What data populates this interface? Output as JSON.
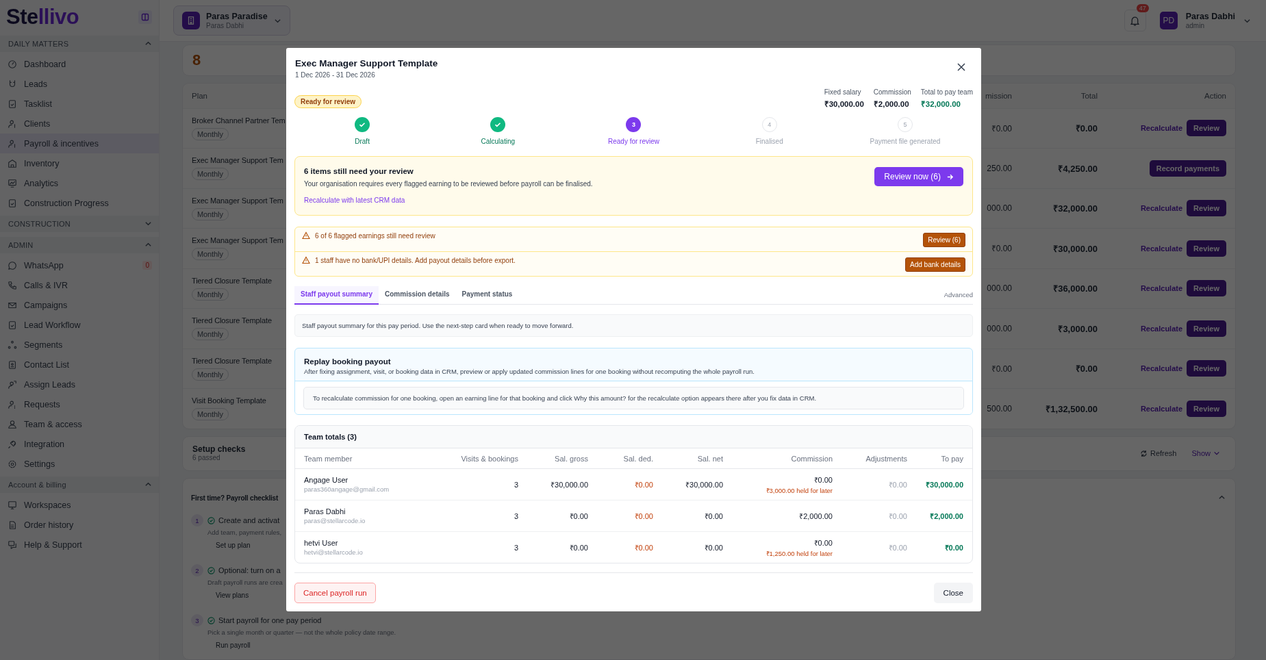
{
  "sidebar": {
    "logo": "Stellivo",
    "sections": [
      {
        "title": "DAILY MATTERS",
        "expanded": true,
        "items": [
          {
            "label": "Dashboard",
            "selected": false
          },
          {
            "label": "Leads",
            "selected": false
          },
          {
            "label": "Tasklist",
            "selected": false
          },
          {
            "label": "Clients",
            "selected": false
          },
          {
            "label": "Payroll & incentives",
            "selected": true
          },
          {
            "label": "Inventory",
            "selected": false
          },
          {
            "label": "Analytics",
            "selected": false
          },
          {
            "label": "Construction Progress",
            "selected": false
          }
        ]
      },
      {
        "title": "CONSTRUCTION",
        "expanded": false
      },
      {
        "title": "ADMIN",
        "expanded": true,
        "items": [
          {
            "label": "WhatsApp",
            "selected": false,
            "badge": "0"
          },
          {
            "label": "Calls & IVR",
            "selected": false
          },
          {
            "label": "Campaigns",
            "selected": false
          },
          {
            "label": "Lead Workflow",
            "selected": false
          },
          {
            "label": "Segments",
            "selected": false
          },
          {
            "label": "Contact List",
            "selected": false
          },
          {
            "label": "Assign Leads",
            "selected": false
          },
          {
            "label": "Requests",
            "selected": false
          },
          {
            "label": "Team & access",
            "selected": false
          },
          {
            "label": "Integration",
            "selected": false
          },
          {
            "label": "Settings",
            "selected": false
          }
        ]
      },
      {
        "title": "Account & billing",
        "expanded": true,
        "items": [
          {
            "label": "Workspaces",
            "selected": false
          },
          {
            "label": "Order history",
            "selected": false
          },
          {
            "label": "Help & Support",
            "selected": false
          }
        ]
      }
    ]
  },
  "topbar": {
    "workspace": {
      "name": "Paras Paradise",
      "owner": "Paras Dabhi"
    },
    "notifications": "47",
    "user": {
      "initials": "PD",
      "name": "Paras Dabhi",
      "role": "admin"
    }
  },
  "background": {
    "stat": "8",
    "table": {
      "columns": [
        "Plan",
        "mission",
        "Total",
        "Action"
      ],
      "rows": [
        {
          "plan": "Broker Channel Partner Tem",
          "frequency": "Monthly",
          "commission": "₹0.00",
          "total": "₹0.00",
          "kind": "review",
          "actions": [
            "Recalculate",
            "Review"
          ]
        },
        {
          "plan": "Exec Manager Support Tem",
          "frequency": "Monthly",
          "commission": "250.00",
          "total": "₹4,250.00",
          "kind": "record",
          "actions": [
            "Record payments"
          ]
        },
        {
          "plan": "Exec Manager Support Tem",
          "frequency": "Monthly",
          "commission": "000.00",
          "total": "₹32,000.00",
          "kind": "review",
          "actions": [
            "Recalculate",
            "Review"
          ]
        },
        {
          "plan": "Exec Manager Support Tem",
          "frequency": "Monthly",
          "commission": "₹0.00",
          "total": "₹30,000.00",
          "kind": "review",
          "actions": [
            "Recalculate",
            "Review"
          ]
        },
        {
          "plan": "Tiered Closure Template",
          "frequency": "Monthly",
          "commission": "000.00",
          "total": "₹36,000.00",
          "kind": "review",
          "actions": [
            "Recalculate",
            "Review"
          ]
        },
        {
          "plan": "Tiered Closure Template",
          "frequency": "Monthly",
          "commission": "000.00",
          "total": "₹3,000.00",
          "kind": "review",
          "actions": [
            "Recalculate",
            "Review"
          ]
        },
        {
          "plan": "Tiered Closure Template",
          "frequency": "Monthly",
          "commission": "₹0.00",
          "total": "₹0.00",
          "kind": "review",
          "actions": [
            "Recalculate",
            "Review"
          ]
        },
        {
          "plan": "Visit Booking Template",
          "frequency": "Monthly",
          "commission": "500.00",
          "total": "₹1,32,500.00",
          "kind": "review",
          "actions": [
            "Recalculate",
            "Review"
          ]
        }
      ]
    },
    "setup_checks": {
      "title": "Setup checks",
      "subtitle": "6 passed",
      "refresh": "Refresh",
      "show": "Show"
    },
    "checklist": {
      "title": "First time? Payroll checklist",
      "expanded": true,
      "steps": [
        {
          "number": "1",
          "title": "Create and activat",
          "text": "Add team, payment rules,",
          "action": "Set up plan"
        },
        {
          "number": "2",
          "title": "Optional: turn on a",
          "text": "Draft payroll runs are crea",
          "action": "View plans"
        },
        {
          "number": "3",
          "title": "Start payroll for one pay period",
          "text": "Pick a single month or quarter — not the whole policy date range.",
          "action": "Run payroll"
        }
      ]
    }
  },
  "modal": {
    "title": "Exec Manager Support Template",
    "period": "1 Dec 2026 - 31 Dec 2026",
    "status": "Ready for review",
    "totals": [
      {
        "label": "Fixed salary",
        "value": "₹30,000.00",
        "highlight": false
      },
      {
        "label": "Commission",
        "value": "₹2,000.00",
        "highlight": false
      },
      {
        "label": "Total to pay team",
        "value": "₹32,000.00",
        "highlight": true
      }
    ],
    "steps": [
      {
        "label": "Draft",
        "completed": true,
        "current": false
      },
      {
        "label": "Calculating",
        "completed": true,
        "current": false
      },
      {
        "number": "3",
        "label": "Ready for review",
        "completed": false,
        "current": true
      },
      {
        "number": "4",
        "label": "Finalised",
        "completed": false,
        "current": false
      },
      {
        "number": "5",
        "label": "Payment file generated",
        "completed": false,
        "current": false
      }
    ],
    "review_card": {
      "title": "6 items still need your review",
      "text": "Your organisation requires every flagged earning to be reviewed before payroll can be finalised.",
      "link": "Recalculate with latest CRM data",
      "button": "Review now (6)"
    },
    "alerts": [
      {
        "text": "6 of 6 flagged earnings still need review",
        "button": "Review (6)"
      },
      {
        "text": "1 staff have no bank/UPI details. Add payout details before export.",
        "button": "Add bank details"
      }
    ],
    "tabs": [
      {
        "label": "Staff payout summary",
        "selected": true
      },
      {
        "label": "Commission details",
        "selected": false
      },
      {
        "label": "Payment status",
        "selected": false
      }
    ],
    "advanced": "Advanced",
    "info": "Staff payout summary for this pay period. Use the next-step card when ready to move forward.",
    "replay": {
      "title": "Replay booking payout",
      "text": "After fixing assignment, visit, or booking data in CRM, preview or apply updated commission lines for one booking without recomputing the whole payroll run.",
      "hint": "To recalculate commission for one booking, open an earning line for that booking and click Why this amount? for the recalculate option appears there after you fix data in CRM."
    },
    "team": {
      "title": "Team totals (3)",
      "columns": [
        "Team member",
        "Visits & bookings",
        "Sal. gross",
        "Sal. ded.",
        "Sal. net",
        "Commission",
        "Adjustments",
        "To pay"
      ],
      "rows": [
        {
          "name": "Angage User",
          "email": "paras360angage@gmail.com",
          "visits": "3",
          "gross": "₹30,000.00",
          "deductions": "₹0.00",
          "net": "₹30,000.00",
          "commission": "₹0.00",
          "held": "₹3,000.00 held for later",
          "adjustments": "₹0.00",
          "to_pay": "₹30,000.00"
        },
        {
          "name": "Paras Dabhi",
          "email": "paras@stellarcode.io",
          "visits": "3",
          "gross": "₹0.00",
          "deductions": "₹0.00",
          "net": "₹0.00",
          "commission": "₹2,000.00",
          "adjustments": "₹0.00",
          "to_pay": "₹2,000.00"
        },
        {
          "name": "hetvi User",
          "email": "hetvi@stellarcode.io",
          "visits": "3",
          "gross": "₹0.00",
          "deductions": "₹0.00",
          "net": "₹0.00",
          "commission": "₹0.00",
          "held": "₹1,250.00 held for later",
          "adjustments": "₹0.00",
          "to_pay": "₹0.00"
        }
      ]
    },
    "footer": {
      "cancel": "Cancel payroll run",
      "close": "Close"
    }
  }
}
